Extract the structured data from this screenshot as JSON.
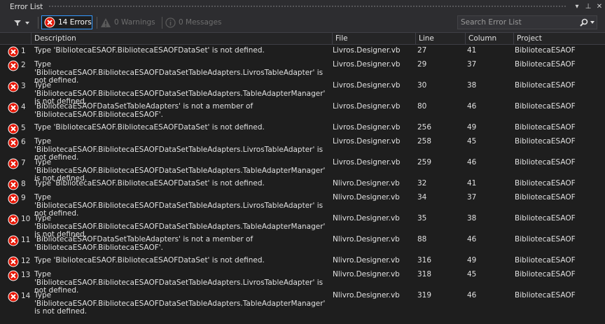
{
  "panel": {
    "title": "Error List",
    "ctl_dropdown": "▾",
    "ctl_pin": "⊥",
    "ctl_close": "✕"
  },
  "toolbar": {
    "errors_label": "14 Errors",
    "warnings_label": "0 Warnings",
    "messages_label": "0 Messages",
    "search_placeholder": "Search Error List"
  },
  "columns": {
    "description": "Description",
    "file": "File",
    "line": "Line",
    "column": "Column",
    "project": "Project"
  },
  "errors": [
    {
      "num": "1",
      "description": "Type 'BibliotecaESAOF.BibliotecaESAOFDataSet' is not defined.",
      "file": "Livros.Designer.vb",
      "line": "27",
      "column": "41",
      "project": "BibliotecaESAOF"
    },
    {
      "num": "2",
      "description": "Type 'BibliotecaESAOF.BibliotecaESAOFDataSetTableAdapters.LivrosTableAdapter' is not defined.",
      "file": "Livros.Designer.vb",
      "line": "29",
      "column": "37",
      "project": "BibliotecaESAOF"
    },
    {
      "num": "3",
      "description": "Type 'BibliotecaESAOF.BibliotecaESAOFDataSetTableAdapters.TableAdapterManager' is not defined.",
      "file": "Livros.Designer.vb",
      "line": "30",
      "column": "38",
      "project": "BibliotecaESAOF"
    },
    {
      "num": "4",
      "description": "'BibliotecaESAOFDataSetTableAdapters' is not a member of 'BibliotecaESAOF.BibliotecaESAOF'.",
      "file": "Livros.Designer.vb",
      "line": "80",
      "column": "46",
      "project": "BibliotecaESAOF"
    },
    {
      "num": "5",
      "description": "Type 'BibliotecaESAOF.BibliotecaESAOFDataSet' is not defined.",
      "file": "Livros.Designer.vb",
      "line": "256",
      "column": "49",
      "project": "BibliotecaESAOF"
    },
    {
      "num": "6",
      "description": "Type 'BibliotecaESAOF.BibliotecaESAOFDataSetTableAdapters.LivrosTableAdapter' is not defined.",
      "file": "Livros.Designer.vb",
      "line": "258",
      "column": "45",
      "project": "BibliotecaESAOF"
    },
    {
      "num": "7",
      "description": "Type 'BibliotecaESAOF.BibliotecaESAOFDataSetTableAdapters.TableAdapterManager' is not defined.",
      "file": "Livros.Designer.vb",
      "line": "259",
      "column": "46",
      "project": "BibliotecaESAOF"
    },
    {
      "num": "8",
      "description": "Type 'BibliotecaESAOF.BibliotecaESAOFDataSet' is not defined.",
      "file": "Nlivro.Designer.vb",
      "line": "32",
      "column": "41",
      "project": "BibliotecaESAOF"
    },
    {
      "num": "9",
      "description": "Type 'BibliotecaESAOF.BibliotecaESAOFDataSetTableAdapters.LivrosTableAdapter' is not defined.",
      "file": "Nlivro.Designer.vb",
      "line": "34",
      "column": "37",
      "project": "BibliotecaESAOF"
    },
    {
      "num": "10",
      "description": "Type 'BibliotecaESAOF.BibliotecaESAOFDataSetTableAdapters.TableAdapterManager' is not defined.",
      "file": "Nlivro.Designer.vb",
      "line": "35",
      "column": "38",
      "project": "BibliotecaESAOF"
    },
    {
      "num": "11",
      "description": "'BibliotecaESAOFDataSetTableAdapters' is not a member of 'BibliotecaESAOF.BibliotecaESAOF'.",
      "file": "Nlivro.Designer.vb",
      "line": "88",
      "column": "46",
      "project": "BibliotecaESAOF"
    },
    {
      "num": "12",
      "description": "Type 'BibliotecaESAOF.BibliotecaESAOFDataSet' is not defined.",
      "file": "Nlivro.Designer.vb",
      "line": "316",
      "column": "49",
      "project": "BibliotecaESAOF"
    },
    {
      "num": "13",
      "description": "Type 'BibliotecaESAOF.BibliotecaESAOFDataSetTableAdapters.LivrosTableAdapter' is not defined.",
      "file": "Nlivro.Designer.vb",
      "line": "318",
      "column": "45",
      "project": "BibliotecaESAOF"
    },
    {
      "num": "14",
      "description": "Type 'BibliotecaESAOF.BibliotecaESAOFDataSetTableAdapters.TableAdapterManager' is not defined.",
      "file": "Nlivro.Designer.vb",
      "line": "319",
      "column": "46",
      "project": "BibliotecaESAOF"
    }
  ],
  "colors": {
    "background": "#1e1e1e",
    "toolbar": "#2d2d30",
    "error_icon": "#e51400",
    "selected_border": "#3399ff"
  }
}
